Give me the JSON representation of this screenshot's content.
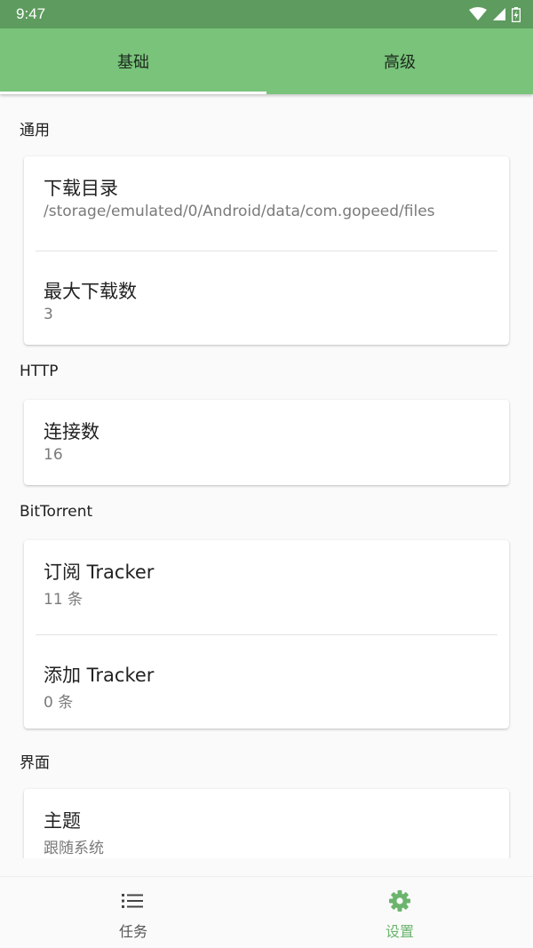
{
  "status_bar": {
    "time": "9:47",
    "icons": [
      "wifi-icon",
      "signal-icon",
      "battery-icon"
    ]
  },
  "tabs": [
    {
      "label": "基础",
      "active": true
    },
    {
      "label": "高级",
      "active": false
    }
  ],
  "sections": [
    {
      "title": "通用",
      "items": [
        {
          "title": "下载目录",
          "subtitle": "/storage/emulated/0/Android/data/com.gopeed/files"
        },
        {
          "title": "最大下载数",
          "subtitle": "3"
        }
      ]
    },
    {
      "title": "HTTP",
      "items": [
        {
          "title": "连接数",
          "subtitle": "16"
        }
      ]
    },
    {
      "title": "BitTorrent",
      "items": [
        {
          "title": "订阅 Tracker",
          "subtitle": "11 条"
        },
        {
          "title": "添加 Tracker",
          "subtitle": "0 条"
        }
      ]
    },
    {
      "title": "界面",
      "items": [
        {
          "title": "主题",
          "subtitle": "跟随系统"
        }
      ]
    }
  ],
  "bottom_nav": [
    {
      "label": "任务",
      "icon": "list-icon",
      "active": false
    },
    {
      "label": "设置",
      "icon": "gear-icon",
      "active": true
    }
  ],
  "colors": {
    "status_bar": "#5d9b5e",
    "app_bar": "#79c37b",
    "accent": "#6bb46d",
    "background": "#fafafa"
  }
}
